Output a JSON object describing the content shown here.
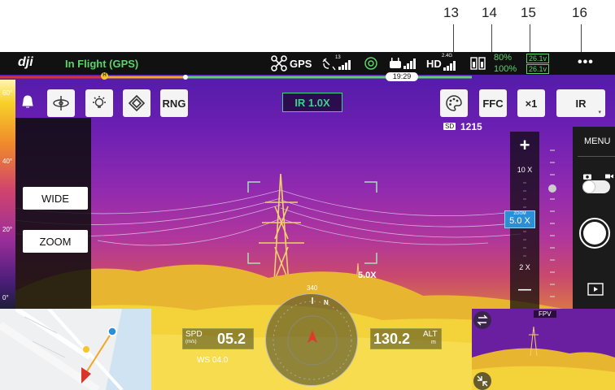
{
  "callouts": [
    "13",
    "14",
    "15",
    "16"
  ],
  "topbar": {
    "logo": "dji",
    "flight_status": "In Flight (GPS)",
    "gps_label": "GPS",
    "sat_count": "13",
    "hd_label": "HD",
    "hd_band": "2.4G",
    "battery_pct_1": "80%",
    "battery_pct_2": "100%",
    "battery_volt_1": "26.1v",
    "battery_volt_2": "26.1v",
    "time": "19:29",
    "more": "•••"
  },
  "temp_scale": [
    "60°",
    "40°",
    "20°",
    "0°"
  ],
  "left_toolbar": {
    "rng_label": "RNG",
    "wide_label": "WIDE",
    "zoom_label": "ZOOM"
  },
  "camera": {
    "ir_zoom": "IR  1.0X",
    "ffc_label": "FFC",
    "zoom_x1": "×1",
    "mode_label": "IR",
    "sd_remaining": "1215",
    "sd_label": "SD"
  },
  "zoom_panel": {
    "plus": "+",
    "minus": "—",
    "ten_x": "10 X",
    "two_x": "2 X",
    "zoom_caption": "ZOOM",
    "zoom_value": "5.0 X"
  },
  "scene": {
    "overlay_zoom": "5.0X"
  },
  "right_panel": {
    "menu": "MENU"
  },
  "telemetry": {
    "spd_label": "SPD",
    "spd_unit": "(m/s)",
    "spd_value": "05.2",
    "ws_text": "WS 04.0",
    "alt_label": "ALT",
    "alt_unit": "m",
    "alt_value": "130.2",
    "compass_top": "340",
    "compass_n": "N",
    "home_marker": "H"
  },
  "fpv": {
    "label": "FPV"
  },
  "colors": {
    "accent_green": "#42d08a",
    "status_green": "#5bd36b",
    "progress_orange": "#f5a623"
  }
}
